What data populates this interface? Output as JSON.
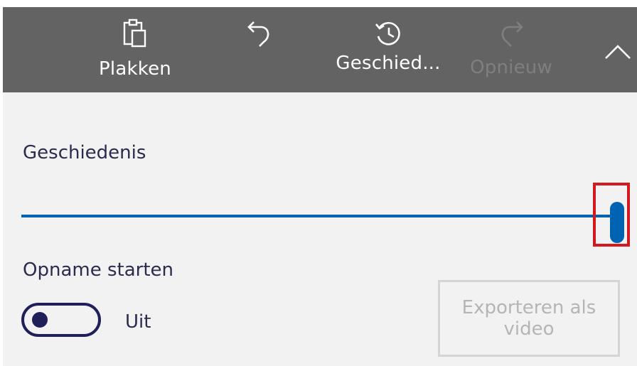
{
  "toolbar": {
    "paste": {
      "label": "Plakken",
      "icon": "clipboard-icon"
    },
    "undo": {
      "icon": "undo-icon"
    },
    "history": {
      "label": "Geschied...",
      "icon": "history-icon"
    },
    "redo": {
      "label": "Opnieuw",
      "icon": "redo-icon",
      "enabled": false
    },
    "collapse": {
      "icon": "chevron-up-icon"
    }
  },
  "history": {
    "title": "Geschiedenis",
    "slider_value": 1.0
  },
  "recording": {
    "title": "Opname starten",
    "toggle_state": "Uit",
    "toggle_on": false
  },
  "export": {
    "label": "Exporteren als video",
    "enabled": false
  },
  "colors": {
    "toolbar_bg": "#636363",
    "panel_bg": "#f2f2f2",
    "accent": "#0063b1",
    "text": "#2b2b4e",
    "highlight": "#d3191e",
    "disabled_text": "#b5b5b5"
  }
}
